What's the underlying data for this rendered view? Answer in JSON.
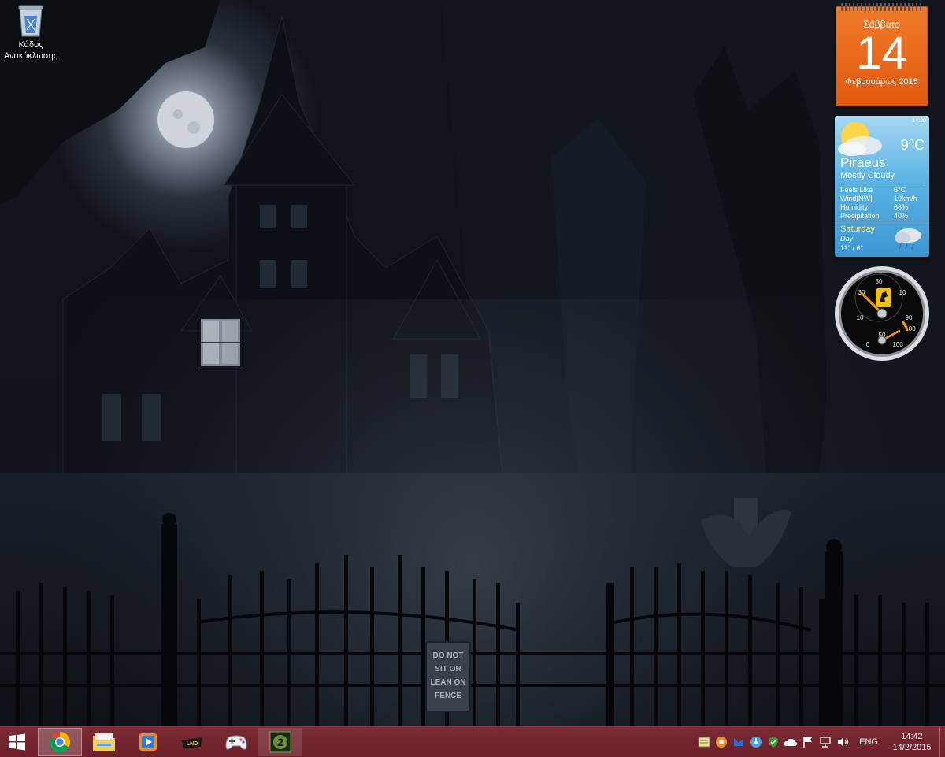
{
  "desktop": {
    "recycle_bin_label": "Κάδος Ανακύκλωσης"
  },
  "wallpaper": {
    "sign_text": [
      "DO NOT",
      "SIT OR",
      "LEAN ON",
      "FENCE"
    ]
  },
  "calendar": {
    "day_name": "Σάββατο",
    "day_number": "14",
    "month_year": "Φεβρουάριος 2015"
  },
  "weather": {
    "updated_time": "14:20",
    "temperature": "9°C",
    "city": "Piraeus",
    "condition": "Mostly Cloudy",
    "details": [
      {
        "label": "Feels Like",
        "value": "6°C"
      },
      {
        "label": "Wind[NW]",
        "value": "19km/h"
      },
      {
        "label": "Humidity",
        "value": "66%"
      },
      {
        "label": "Precipitation",
        "value": "40%"
      }
    ],
    "forecast": {
      "day": "Saturday",
      "part": "Day",
      "range": "11° /  6°"
    }
  },
  "gauge": {
    "labels": [
      "50",
      "30",
      "10",
      "10",
      "90",
      "100",
      "0",
      "50",
      "100"
    ]
  },
  "taskbar": {
    "apps": [
      {
        "name": "chrome-icon",
        "active": true
      },
      {
        "name": "file-explorer-icon",
        "active": false
      },
      {
        "name": "media-player-icon",
        "active": false
      },
      {
        "name": "lindenfield-icon",
        "active": false
      },
      {
        "name": "gamepad-icon",
        "active": false
      },
      {
        "name": "modern-warfare-2-icon",
        "active": false
      }
    ],
    "tray": {
      "language": "ENG",
      "time": "14:42",
      "date": "14/2/2015"
    }
  },
  "colors": {
    "taskbar": "#6c2029",
    "calendar": "#e86a1c",
    "weather": "#5cb4e4"
  }
}
